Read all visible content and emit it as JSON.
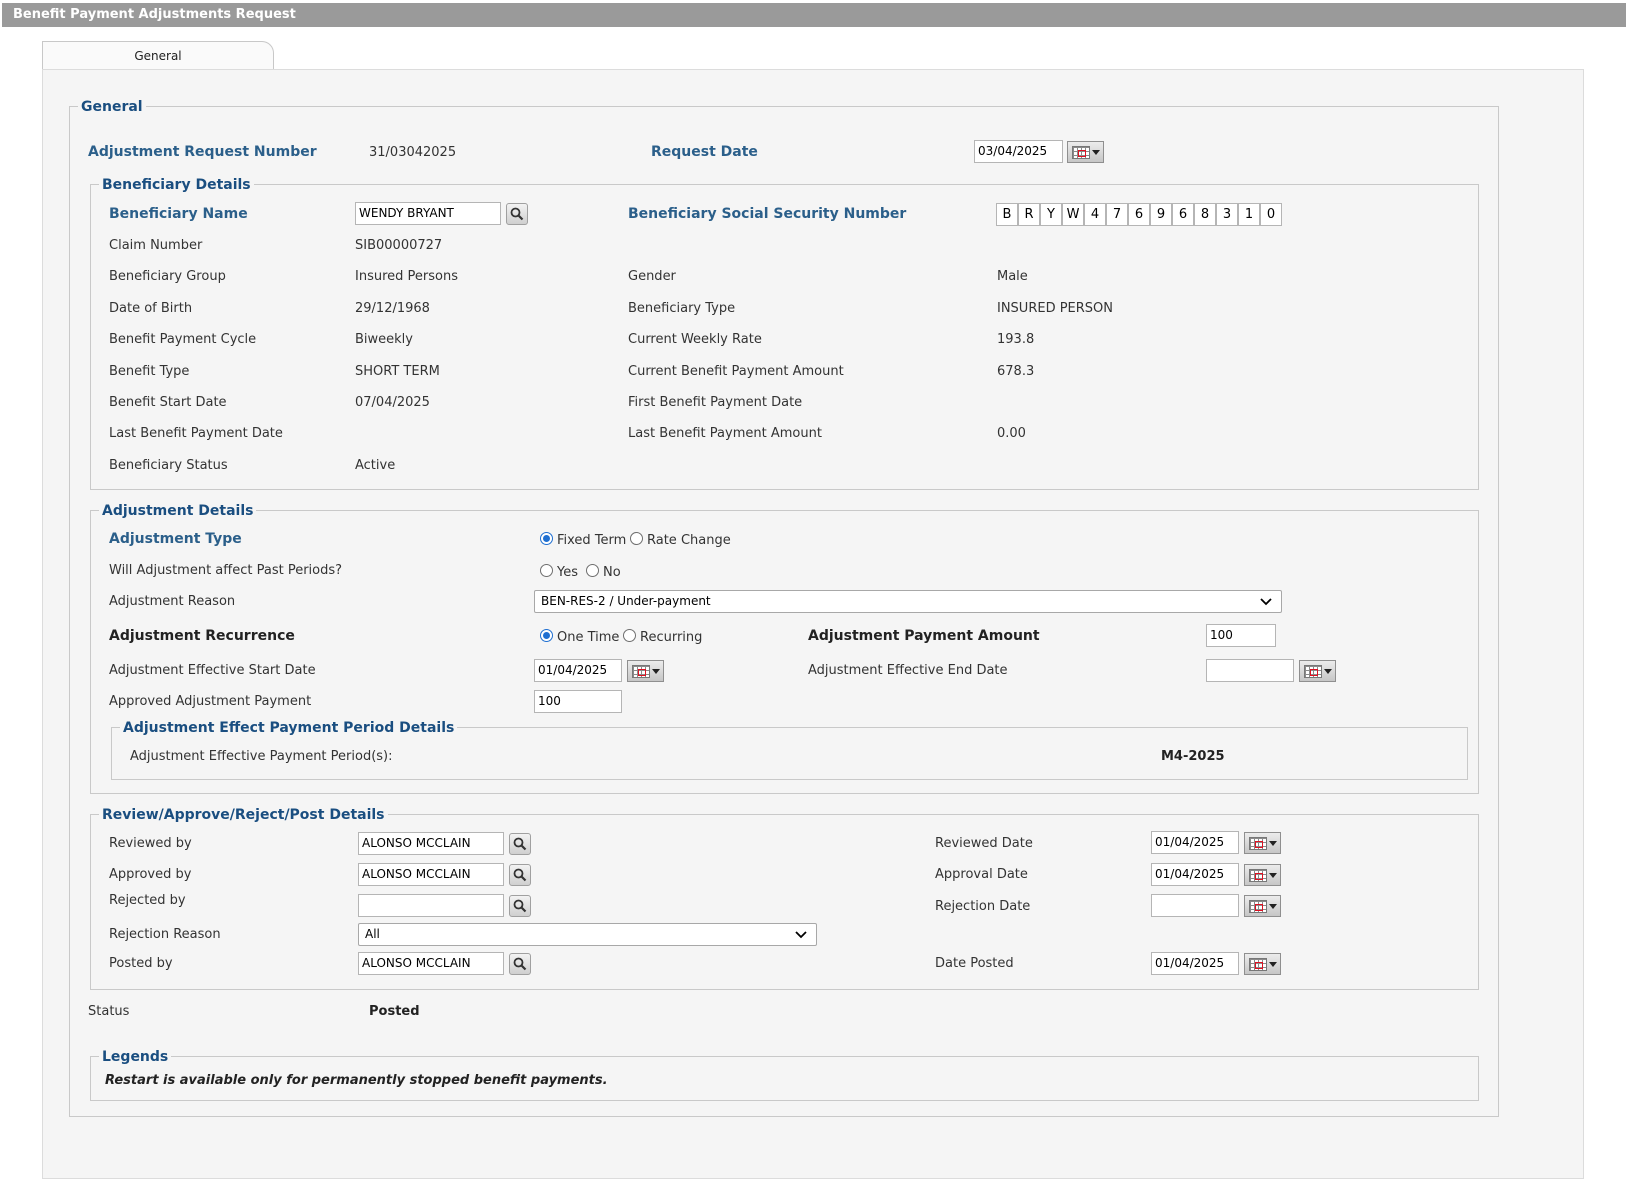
{
  "window_title": "Benefit Payment Adjustments Request",
  "tab_general": "General",
  "general": {
    "legend": "General",
    "adjustment_request_number_label": "Adjustment Request Number",
    "adjustment_request_number": "31/03042025",
    "request_date_label": "Request Date",
    "request_date": "03/04/2025"
  },
  "beneficiary": {
    "legend": "Beneficiary Details",
    "name_label": "Beneficiary Name",
    "name": "WENDY BRYANT",
    "ssn_label": "Beneficiary Social Security Number",
    "ssn_chars": [
      "B",
      "R",
      "Y",
      "W",
      "4",
      "7",
      "6",
      "9",
      "6",
      "8",
      "3",
      "1",
      "0"
    ],
    "claim_number_label": "Claim Number",
    "claim_number": "SIB00000727",
    "group_label": "Beneficiary Group",
    "group": "Insured Persons",
    "gender_label": "Gender",
    "gender": "Male",
    "dob_label": "Date of Birth",
    "dob": "29/12/1968",
    "type_label": "Beneficiary Type",
    "type": "INSURED PERSON",
    "cycle_label": "Benefit Payment Cycle",
    "cycle": "Biweekly",
    "weekly_rate_label": "Current Weekly Rate",
    "weekly_rate": "193.8",
    "benefit_type_label": "Benefit Type",
    "benefit_type": "SHORT TERM",
    "current_amount_label": "Current Benefit Payment Amount",
    "current_amount": "678.3",
    "start_date_label": "Benefit Start Date",
    "start_date": "07/04/2025",
    "first_payment_label": "First Benefit Payment Date",
    "first_payment": "",
    "last_payment_date_label": "Last Benefit Payment Date",
    "last_payment_date": "",
    "last_payment_amount_label": "Last Benefit Payment Amount",
    "last_payment_amount": "0.00",
    "status_label": "Beneficiary Status",
    "status": "Active"
  },
  "adjustment": {
    "legend": "Adjustment Details",
    "type_label": "Adjustment Type",
    "type_fixed": "Fixed Term",
    "type_rate": "Rate Change",
    "past_label": "Will Adjustment affect Past Periods?",
    "past_yes": "Yes",
    "past_no": "No",
    "reason_label": "Adjustment Reason",
    "reason": "BEN-RES-2 / Under-payment",
    "recurrence_label": "Adjustment Recurrence",
    "recurrence_one": "One Time",
    "recurrence_recurring": "Recurring",
    "payment_amount_label": "Adjustment Payment Amount",
    "payment_amount": "100",
    "eff_start_label": "Adjustment Effective Start Date",
    "eff_start": "01/04/2025",
    "eff_end_label": "Adjustment Effective End Date",
    "eff_end": "",
    "approved_label": "Approved Adjustment Payment",
    "approved": "100",
    "period_legend": "Adjustment Effect Payment Period Details",
    "period_label": "Adjustment Effective Payment Period(s):",
    "period_value": "M4-2025"
  },
  "review": {
    "legend": "Review/Approve/Reject/Post Details",
    "reviewed_by_label": "Reviewed by",
    "reviewed_by": "ALONSO MCCLAIN",
    "reviewed_date_label": "Reviewed Date",
    "reviewed_date": "01/04/2025",
    "approved_by_label": "Approved by",
    "approved_by": "ALONSO MCCLAIN",
    "approval_date_label": "Approval Date",
    "approval_date": "01/04/2025",
    "rejected_by_label": "Rejected by",
    "rejected_by": "",
    "rejection_date_label": "Rejection Date",
    "rejection_date": "",
    "rejection_reason_label": "Rejection Reason",
    "rejection_reason": "All",
    "posted_by_label": "Posted by",
    "posted_by": "ALONSO MCCLAIN",
    "date_posted_label": "Date Posted",
    "date_posted": "01/04/2025"
  },
  "status": {
    "label": "Status",
    "value": "Posted"
  },
  "legends": {
    "legend": "Legends",
    "note": "Restart is available only for permanently stopped benefit payments."
  }
}
